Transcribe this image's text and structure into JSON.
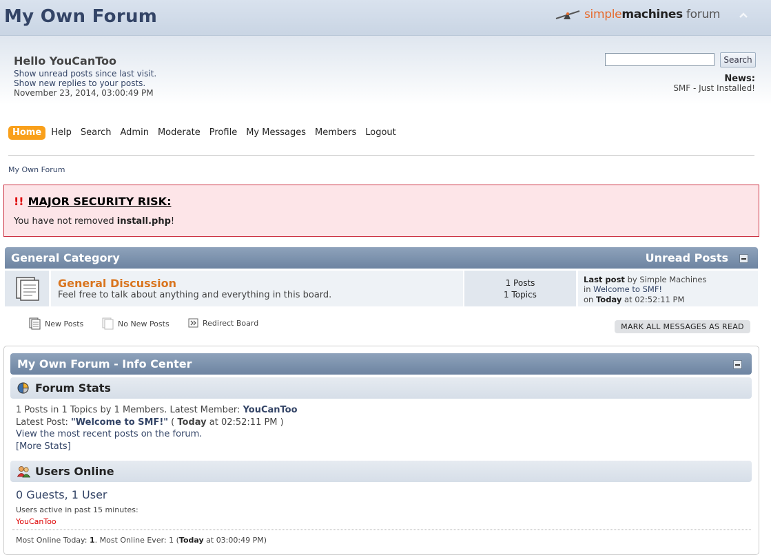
{
  "header": {
    "forum_title": "My Own Forum",
    "logo_text_1": "simple",
    "logo_text_2": "machines",
    "logo_text_3": "forum",
    "collapse_glyph": "^"
  },
  "user": {
    "greeting": "Hello YouCanToo",
    "unread_link": "Show unread posts since last visit.",
    "replies_link": "Show new replies to your posts.",
    "date": "November 23, 2014, 03:00:49 PM"
  },
  "search": {
    "value": "",
    "button_label": "Search"
  },
  "news": {
    "title": "News:",
    "text": "SMF - Just Installed!"
  },
  "menu": {
    "items": [
      "Home",
      "Help",
      "Search",
      "Admin",
      "Moderate",
      "Profile",
      "My Messages",
      "Members",
      "Logout"
    ],
    "active": "Home"
  },
  "breadcrumb": "My Own Forum",
  "security": {
    "bang": "!!",
    "title": "MAJOR SECURITY RISK:",
    "msg_before": "You have not removed ",
    "msg_file": "install.php",
    "msg_after": "!"
  },
  "category": {
    "title": "General Category",
    "unread_label": "Unread Posts",
    "board": {
      "name": "General Discussion",
      "description": "Feel free to talk about anything and everything in this board.",
      "posts": "1 Posts",
      "topics": "1 Topics",
      "last_post_label": "Last post",
      "last_post_by": " by Simple Machines",
      "last_post_in": "in ",
      "last_post_topic": "Welcome to SMF!",
      "last_post_on": "on ",
      "last_post_day": "Today",
      "last_post_time": " at 02:52:11 PM"
    }
  },
  "legend": {
    "new_posts": "New Posts",
    "no_new_posts": "No New Posts",
    "redirect_board": "Redirect Board",
    "mark_all_read": "MARK ALL MESSAGES AS READ"
  },
  "info_center": {
    "title": "My Own Forum - Info Center",
    "forum_stats": {
      "title": "Forum Stats",
      "line1_prefix": "1 Posts in 1 Topics by 1 Members. Latest Member: ",
      "latest_member": "YouCanToo",
      "line2_prefix": "Latest Post: ",
      "latest_post": "\"Welcome to SMF!\"",
      "line2_open": " ( ",
      "line2_day": "Today",
      "line2_time": " at 02:52:11 PM )",
      "recent_link": "View the most recent posts on the forum.",
      "more_stats": "[More Stats]"
    },
    "users_online": {
      "title": "Users Online",
      "count": "0 Guests, 1 User",
      "active_label": "Users active in past 15 minutes:",
      "user": "YouCanToo",
      "most_prefix": "Most Online Today: ",
      "most_today": "1",
      "most_mid": ". Most Online Ever: 1 (",
      "most_day": "Today",
      "most_time": " at 03:00:49 PM)"
    }
  }
}
